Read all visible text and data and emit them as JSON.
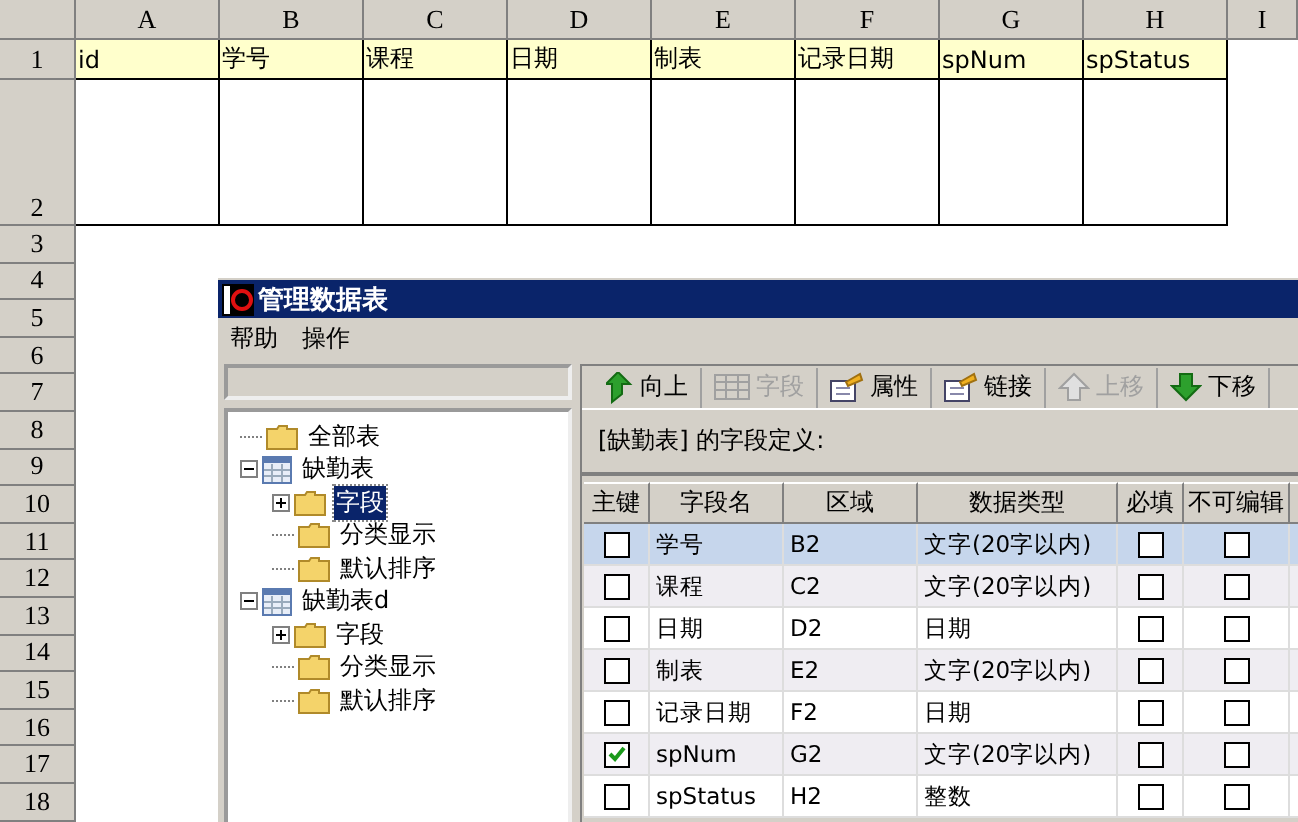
{
  "sheet": {
    "columns": [
      "A",
      "B",
      "C",
      "D",
      "E",
      "F",
      "G",
      "H",
      "I"
    ],
    "row_numbers": [
      "1",
      "2",
      "3",
      "4",
      "5",
      "6",
      "7",
      "8",
      "9",
      "10",
      "11",
      "12",
      "13",
      "14",
      "15",
      "16",
      "17",
      "18"
    ],
    "header_cells": [
      "id",
      "学号",
      "课程",
      "日期",
      "制表",
      "记录日期",
      "spNum",
      "spStatus"
    ]
  },
  "dialog": {
    "title": "管理数据表",
    "menu": [
      "帮助",
      "操作"
    ],
    "tree": [
      {
        "label": "全部表",
        "kind": "folder",
        "selected": false
      },
      {
        "label": "缺勤表",
        "kind": "table",
        "expanded": true,
        "selected": false,
        "children": [
          {
            "label": "字段",
            "kind": "group",
            "expanded": false,
            "selected": true
          },
          {
            "label": "分类显示",
            "kind": "folder",
            "selected": false
          },
          {
            "label": "默认排序",
            "kind": "folder",
            "selected": false
          }
        ]
      },
      {
        "label": "缺勤表d",
        "kind": "table",
        "expanded": true,
        "selected": false,
        "children": [
          {
            "label": "字段",
            "kind": "group",
            "expanded": false,
            "selected": false
          },
          {
            "label": "分类显示",
            "kind": "folder",
            "selected": false
          },
          {
            "label": "默认排序",
            "kind": "folder",
            "selected": false
          }
        ]
      }
    ],
    "toolbar": [
      {
        "label": "向上",
        "kind": "up",
        "disabled": false
      },
      {
        "label": "字段",
        "kind": "grid",
        "disabled": true
      },
      {
        "label": "属性",
        "kind": "doc",
        "disabled": false
      },
      {
        "label": "链接",
        "kind": "doc",
        "disabled": false
      },
      {
        "label": "上移",
        "kind": "moveup",
        "disabled": true
      },
      {
        "label": "下移",
        "kind": "movedown",
        "disabled": false
      }
    ],
    "caption": "[缺勤表] 的字段定义:",
    "columns": [
      "主键",
      "字段名",
      "区域",
      "数据类型",
      "必填",
      "不可编辑"
    ],
    "rows": [
      {
        "primary_key": false,
        "name": "学号",
        "range": "B2",
        "type": "文字(20字以内)",
        "required": false,
        "readonly": false,
        "selected": true
      },
      {
        "primary_key": false,
        "name": "课程",
        "range": "C2",
        "type": "文字(20字以内)",
        "required": false,
        "readonly": false,
        "selected": false
      },
      {
        "primary_key": false,
        "name": "日期",
        "range": "D2",
        "type": "日期",
        "required": false,
        "readonly": false,
        "selected": false
      },
      {
        "primary_key": false,
        "name": "制表",
        "range": "E2",
        "type": "文字(20字以内)",
        "required": false,
        "readonly": false,
        "selected": false
      },
      {
        "primary_key": false,
        "name": "记录日期",
        "range": "F2",
        "type": "日期",
        "required": false,
        "readonly": false,
        "selected": false
      },
      {
        "primary_key": true,
        "name": "spNum",
        "range": "G2",
        "type": "文字(20字以内)",
        "required": false,
        "readonly": false,
        "selected": false
      },
      {
        "primary_key": false,
        "name": "spStatus",
        "range": "H2",
        "type": "整数",
        "required": false,
        "readonly": false,
        "selected": false
      }
    ]
  }
}
